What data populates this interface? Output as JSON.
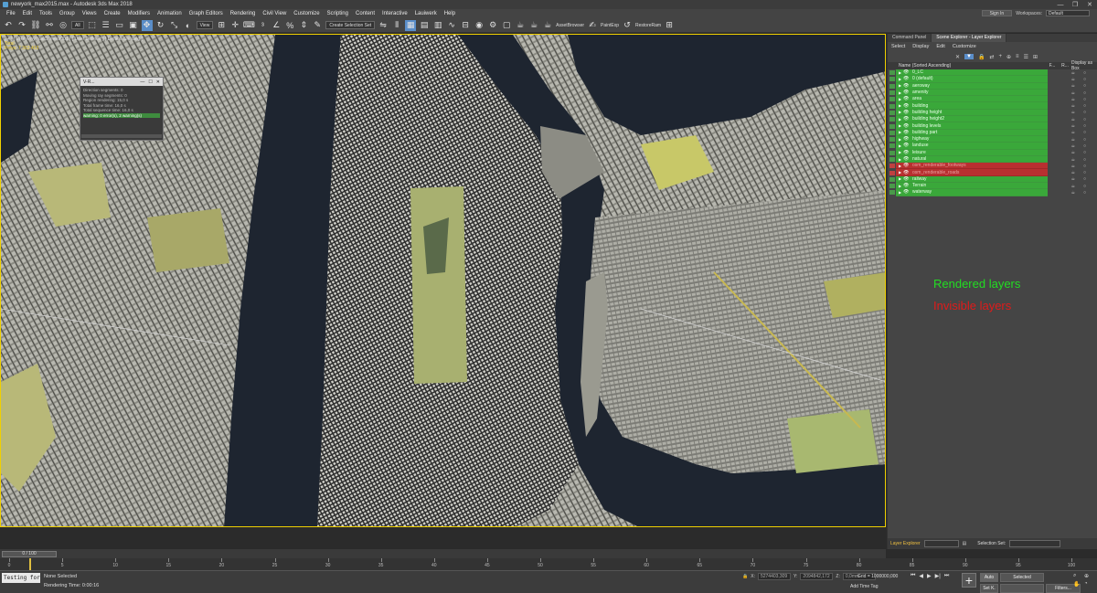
{
  "window": {
    "title": "newyork_max2015.max - Autodesk 3ds Max 2018",
    "minimize": "—",
    "maximize": "❐",
    "close": "✕"
  },
  "menu": {
    "items": [
      "File",
      "Edit",
      "Tools",
      "Group",
      "Views",
      "Create",
      "Modifiers",
      "Animation",
      "Graph Editors",
      "Rendering",
      "Civil View",
      "Customize",
      "Scripting",
      "Content",
      "Interactive",
      "Lauiwerk",
      "Help"
    ],
    "sign_in": "Sign In",
    "workspaces_label": "Workspaces:",
    "workspace_value": "Default"
  },
  "toolbar": {
    "filter_value": "All",
    "view_value": "View",
    "selection_set": "Create Selection Set",
    "asset_browser": "AssetBrowser",
    "paint_exp": "PaintExp",
    "restore_ram": "RestoreRam"
  },
  "viewport": {
    "label": "[ + ] [ VRayPhysicalCamera001 ] [ User Defined ] [ Default Shading ]",
    "stats_total": "Total",
    "stats_polys": "Polys: 7 363 463"
  },
  "vray_log": {
    "title": "V-R...",
    "lines": [
      "Direction segments: 0",
      "Moving ray segments: 0",
      "Region rendering: 15,0 s",
      "Total frame time: 16,0 s",
      "Total sequence time: 16,0 s"
    ],
    "highlight": "warning: 0 error(s), 2 warning(s)"
  },
  "scene_explorer": {
    "tabs": [
      "Command Panel",
      "Scene Explorer - Layer Explorer"
    ],
    "menu": [
      "Select",
      "Display",
      "Edit",
      "Customize"
    ],
    "header_name": "Name (Sorted Ascending)",
    "header_f": "F...",
    "header_r": "R...",
    "header_box": "Display as Box",
    "layers": [
      {
        "name": "0_LC",
        "state": "rendered"
      },
      {
        "name": "0 (default)",
        "state": "rendered"
      },
      {
        "name": "aeroway",
        "state": "rendered"
      },
      {
        "name": "amenity",
        "state": "rendered"
      },
      {
        "name": "area",
        "state": "rendered"
      },
      {
        "name": "building",
        "state": "rendered"
      },
      {
        "name": "building height",
        "state": "rendered"
      },
      {
        "name": "building height2",
        "state": "rendered"
      },
      {
        "name": "building levels",
        "state": "rendered"
      },
      {
        "name": "building part",
        "state": "rendered"
      },
      {
        "name": "highway",
        "state": "rendered"
      },
      {
        "name": "landuse",
        "state": "rendered"
      },
      {
        "name": "leisure",
        "state": "rendered"
      },
      {
        "name": "natural",
        "state": "rendered"
      },
      {
        "name": "osm_renderable_footways",
        "state": "hidden"
      },
      {
        "name": "osm_renderable_roads",
        "state": "hidden"
      },
      {
        "name": "railway",
        "state": "rendered"
      },
      {
        "name": "Terrain",
        "state": "rendered"
      },
      {
        "name": "waterway",
        "state": "rendered"
      }
    ],
    "legend_rendered": "Rendered layers",
    "legend_invisible": "Invisible layers",
    "footer_label": "Layer Explorer",
    "selection_set_label": "Selection Set:"
  },
  "timeline": {
    "slider": "0 / 100",
    "ticks": [
      "0",
      "5",
      "10",
      "15",
      "20",
      "25",
      "30",
      "35",
      "40",
      "45",
      "50",
      "55",
      "60",
      "65",
      "70",
      "75",
      "80",
      "85",
      "90",
      "95",
      "100"
    ]
  },
  "status": {
    "maxscript": "Testing for",
    "selection": "None Selected",
    "render_time": "Rendering Time: 0:00:16",
    "x_label": "X:",
    "y_label": "Y:",
    "z_label": "Z:",
    "x_value": "5274403,309",
    "y_value": "2094842,172",
    "z_value": "0,0mm",
    "grid": "Grid = 1000000,000",
    "add_time_tag": "Add Time Tag",
    "auto": "Auto",
    "selected": "Selected",
    "set_k": "Set K.",
    "filters": "Filters..."
  },
  "colors": {
    "rendered": "#3aa83a",
    "hidden": "#b83030",
    "legend_green": "#22dd22",
    "legend_red": "#e01a1a",
    "viewport_border": "#f0d000"
  }
}
